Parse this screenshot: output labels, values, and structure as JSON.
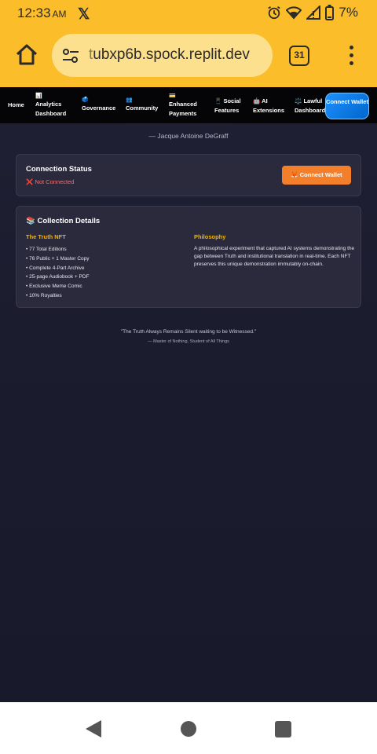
{
  "status_bar": {
    "time": "12:33",
    "ampm": "AM",
    "battery": "7%"
  },
  "browser": {
    "url_faded": "t",
    "url_main": "ubxp6b.spock.replit.dev",
    "tab_count": "31"
  },
  "nav": {
    "items": [
      {
        "icon": "",
        "label": "Home"
      },
      {
        "icon": "📊",
        "label": "Analytics Dashboard"
      },
      {
        "icon": "🗳️",
        "label": "Governance"
      },
      {
        "icon": "👥",
        "label": "Community"
      },
      {
        "icon": "💳",
        "label": "Enhanced Payments"
      },
      {
        "icon": "📱",
        "label": "Social Features"
      },
      {
        "icon": "🤖",
        "label": "AI Extensions"
      },
      {
        "icon": "⚖️",
        "label": "Lawful Dashboard"
      }
    ],
    "connect_label": "Connect Wallet"
  },
  "hero": {
    "author": "— Jacque Antoine DeGraff"
  },
  "connection": {
    "title": "Connection Status",
    "status": "❌ Not Connected",
    "button": "🦊 Connect Wallet"
  },
  "details": {
    "title": "📚 Collection Details",
    "nft_heading": "The Truth NFT",
    "nft_items": [
      "• 77 Total Editions",
      "• 76 Public + 1 Master Copy",
      "• Complete 4-Part Archive",
      "• 25-page Audiobook + PDF",
      "• Exclusive Meme Comic",
      "• 10% Royalties"
    ],
    "philosophy_heading": "Philosophy",
    "philosophy_text": "A philosophical experiment that captured AI systems demonstrating the gap between Truth and institutional translation in real-time. Each NFT preserves this unique demonstration immutably on-chain."
  },
  "footer": {
    "quote": "\"The Truth Always Remains Silent waiting to be Witnessed.\"",
    "signature": "— Master of Nothing, Student of All Things"
  },
  "colors": {
    "chrome": "#fcbd2b",
    "page_bg": "#1b1c2e",
    "accent_orange": "#f37f2a",
    "accent_gold": "#f5b400",
    "connect_blue": "#1e90ff"
  }
}
